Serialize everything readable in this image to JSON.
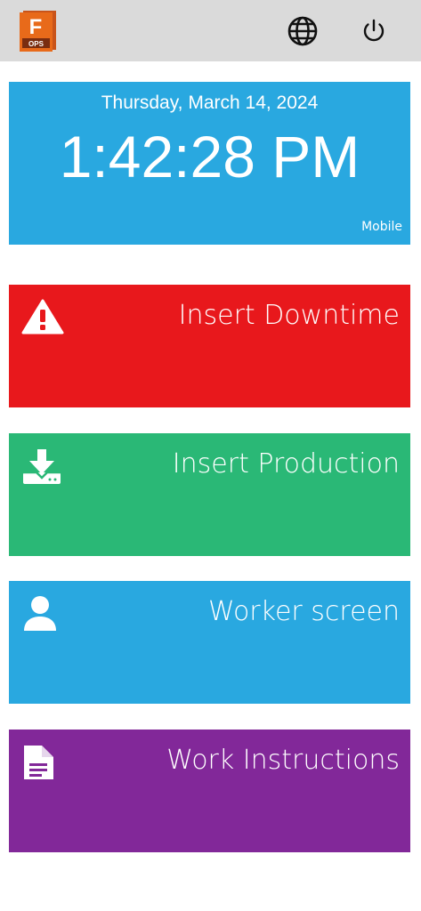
{
  "header": {
    "logo_letter": "F",
    "logo_sub": "OPS",
    "logo_color": "#e86a1a",
    "icons": [
      "globe-icon",
      "power-icon"
    ]
  },
  "clock": {
    "date": "Thursday, March 14, 2024",
    "time": "1:42:28 PM",
    "mode": "Mobile",
    "color": "#29a8e0"
  },
  "tiles": [
    {
      "label": "Insert Downtime",
      "icon": "warning-icon",
      "color": "#e8181c"
    },
    {
      "label": "Insert Production",
      "icon": "download-icon",
      "color": "#2ab876"
    },
    {
      "label": "Worker screen",
      "icon": "user-icon",
      "color": "#29a8e0"
    },
    {
      "label": "Work Instructions",
      "icon": "document-icon",
      "color": "#822899"
    }
  ]
}
